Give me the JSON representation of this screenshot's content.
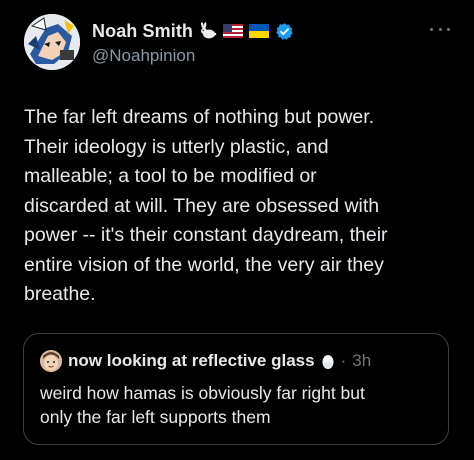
{
  "author": {
    "display_name": "Noah Smith",
    "handle": "@Noahpinion",
    "badges": [
      "rabbit-icon",
      "us-flag-icon",
      "ukraine-flag-icon",
      "verified-badge-icon"
    ]
  },
  "tweet": {
    "text": "The far left dreams of nothing but power.\nTheir ideology is utterly plastic, and\nmalleable; a tool to be modified or\ndiscarded at will. They are obsessed with\npower -- it's their constant daydream, their\nentire vision of the world, the very air they\nbreathe."
  },
  "quoted_tweet": {
    "display_name": "now looking at reflective glass",
    "separator": "·",
    "timestamp": "3h",
    "text": "weird how hamas is obviously far right but\nonly the far left supports them",
    "icons": [
      "avatar",
      "egg-icon"
    ]
  },
  "colors": {
    "background": "#000000",
    "text_primary": "#e7e9ea",
    "text_secondary": "#71767b",
    "verified": "#1d9bf0",
    "border": "#3b4045"
  }
}
